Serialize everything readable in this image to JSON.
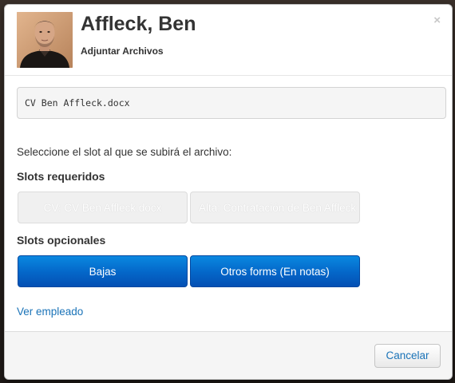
{
  "modal": {
    "title": "Affleck, Ben",
    "subtitle": "Adjuntar Archivos",
    "close_glyph": "×",
    "avatar_icon": "person-portrait"
  },
  "file": {
    "name": "CV Ben Affleck.docx"
  },
  "instruction": "Seleccione el slot al que se subirá el archivo:",
  "required": {
    "heading": "Slots requeridos",
    "slots": [
      {
        "label": "CV: CV Ben Affleck.docx",
        "state": "disabled"
      },
      {
        "label": "Alta: Contratación de Ben Affleck",
        "state": "disabled"
      }
    ]
  },
  "optional": {
    "heading": "Slots opcionales",
    "slots": [
      {
        "label": "Bajas",
        "state": "enabled"
      },
      {
        "label": "Otros forms (En notas)",
        "state": "enabled"
      }
    ]
  },
  "link": "Ver empleado",
  "footer": {
    "cancel_label": "Cancelar"
  },
  "colors": {
    "primary": "#0466c8",
    "link": "#1a73b8"
  }
}
